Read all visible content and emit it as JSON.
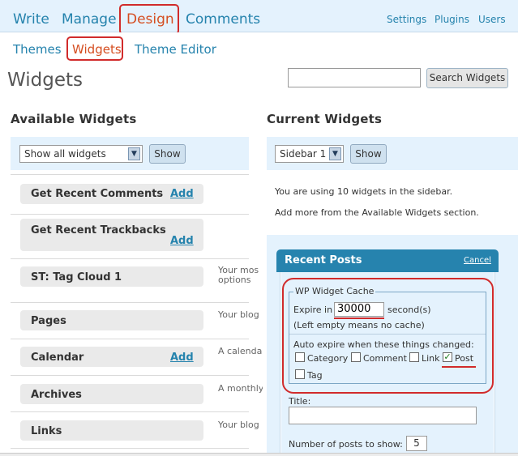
{
  "main_nav": [
    "Write",
    "Manage",
    "Design",
    "Comments"
  ],
  "secondary_nav": [
    "Settings",
    "Plugins",
    "Users"
  ],
  "sub_nav": [
    "Themes",
    "Widgets",
    "Theme Editor"
  ],
  "page_title": "Widgets",
  "search": {
    "value": "",
    "button_label": "Search Widgets"
  },
  "available": {
    "heading": "Available Widgets",
    "filter_value": "Show all widgets",
    "show_label": "Show",
    "widgets": [
      {
        "name": "Get Recent Comments",
        "add": "Add",
        "desc": ""
      },
      {
        "name": "Get Recent Trackbacks",
        "add": "Add",
        "desc": ""
      },
      {
        "name": "ST: Tag Cloud 1",
        "add": "",
        "desc": "Your mos",
        "desc2": "options"
      },
      {
        "name": "Pages",
        "add": "",
        "desc": "Your blog"
      },
      {
        "name": "Calendar",
        "add": "Add",
        "desc": "A calenda"
      },
      {
        "name": "Archives",
        "add": "",
        "desc": "A monthly"
      },
      {
        "name": "Links",
        "add": "",
        "desc": "Your blog"
      }
    ]
  },
  "current": {
    "heading": "Current Widgets",
    "sidebar_value": "Sidebar 1",
    "show_label": "Show",
    "info_line1": "You are using 10 widgets in the sidebar.",
    "info_line2": "Add more from the Available Widgets section."
  },
  "recent_posts": {
    "title": "Recent Posts",
    "cancel": "Cancel",
    "cache_legend": "WP Widget Cache",
    "expire_label": "Expire in",
    "expire_value": "30000",
    "expire_unit": "second(s)",
    "expire_note": "(Left empty means no cache)",
    "auto_expire_label": "Auto expire when these things changed:",
    "checkboxes": [
      {
        "label": "Category",
        "checked": ""
      },
      {
        "label": "Comment",
        "checked": ""
      },
      {
        "label": "Link",
        "checked": ""
      },
      {
        "label": "Post",
        "checked": "✓"
      },
      {
        "label": "Tag",
        "checked": ""
      }
    ],
    "title_label": "Title:",
    "title_value": "",
    "num_label": "Number of posts to show:",
    "num_value": "5"
  },
  "colors": {
    "accent": "#2583ad",
    "current": "#d54e21",
    "highlight": "#d12b2b",
    "panel": "#e4f2fd"
  }
}
